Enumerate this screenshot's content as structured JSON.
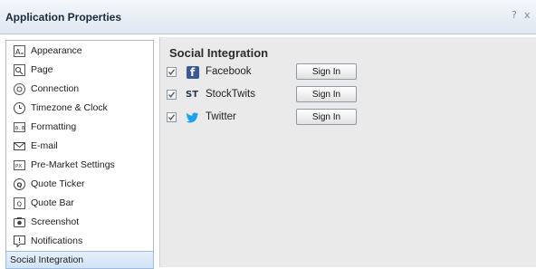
{
  "window": {
    "title": "Application Properties",
    "help_glyph": "?",
    "close_glyph": "x"
  },
  "sidebar": {
    "items": [
      {
        "label": "Appearance",
        "icon": "appearance-icon"
      },
      {
        "label": "Page",
        "icon": "page-icon"
      },
      {
        "label": "Connection",
        "icon": "connection-icon"
      },
      {
        "label": "Timezone & Clock",
        "icon": "clock-icon"
      },
      {
        "label": "Formatting",
        "icon": "formatting-icon"
      },
      {
        "label": "E-mail",
        "icon": "email-icon"
      },
      {
        "label": "Pre-Market Settings",
        "icon": "premarket-icon"
      },
      {
        "label": "Quote Ticker",
        "icon": "quote-ticker-icon"
      },
      {
        "label": "Quote Bar",
        "icon": "quote-bar-icon"
      },
      {
        "label": "Screenshot",
        "icon": "camera-icon"
      },
      {
        "label": "Notifications",
        "icon": "notification-icon"
      },
      {
        "label": "Social Integration",
        "icon": "",
        "selected": true
      }
    ]
  },
  "panel": {
    "title": "Social Integration",
    "services": [
      {
        "name": "Facebook",
        "checked": true,
        "icon": "facebook-icon",
        "button": "Sign In",
        "brand_glyph": "f"
      },
      {
        "name": "StockTwits",
        "checked": true,
        "icon": "stocktwits-icon",
        "button": "Sign In",
        "brand_glyph": "ST"
      },
      {
        "name": "Twitter",
        "checked": true,
        "icon": "twitter-icon",
        "button": "Sign In",
        "brand_glyph": ""
      }
    ]
  },
  "colors": {
    "facebook": "#3b5998",
    "twitter": "#1da1f2",
    "stocktwits": "#2a3b4c",
    "selected_bg": "#d2e3f6"
  }
}
